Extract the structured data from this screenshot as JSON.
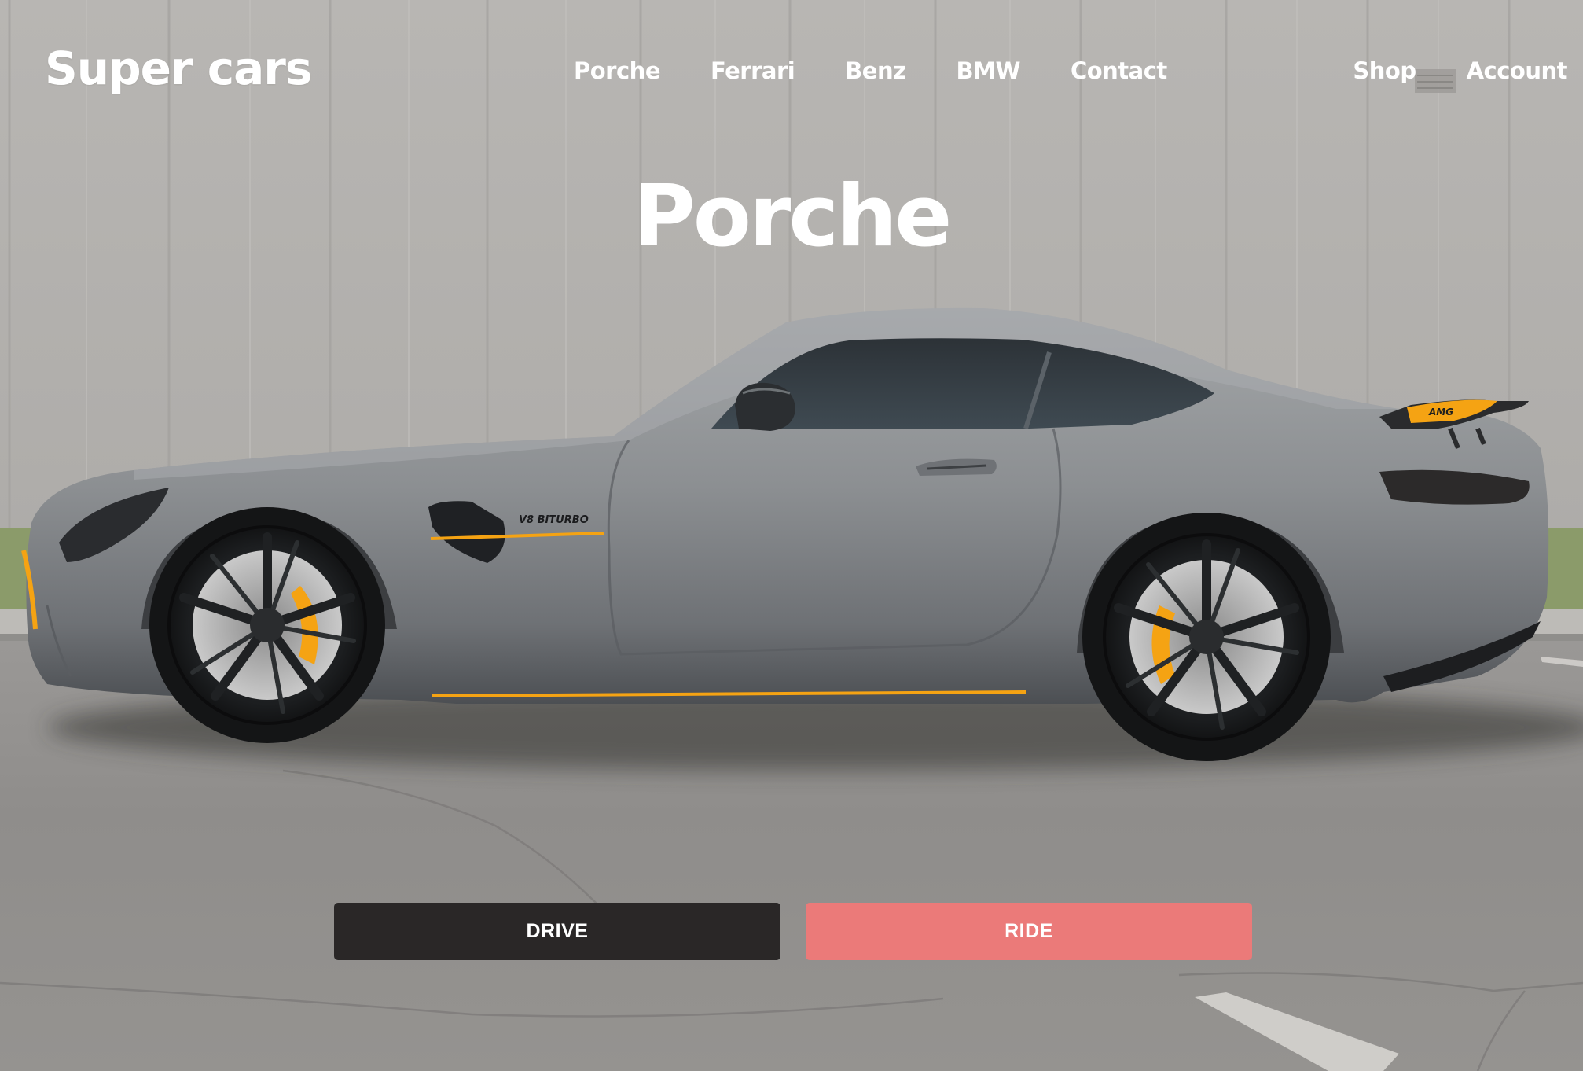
{
  "header": {
    "logo": "Super cars",
    "nav": [
      {
        "label": "Porche"
      },
      {
        "label": "Ferrari"
      },
      {
        "label": "Benz"
      },
      {
        "label": "BMW"
      },
      {
        "label": "Contact"
      }
    ],
    "right_nav": [
      {
        "label": "Shop"
      },
      {
        "label": "Account"
      }
    ]
  },
  "hero": {
    "title": "Porche",
    "image": {
      "car_badge": "V8 BITURBO",
      "wing_badge": "AMG"
    }
  },
  "actions": {
    "drive_label": "DRIVE",
    "ride_label": "RIDE"
  },
  "colors": {
    "drive_button": "#2a2727",
    "ride_button": "#eb7a79",
    "text": "#ffffff",
    "accent_orange": "#f5a313"
  }
}
